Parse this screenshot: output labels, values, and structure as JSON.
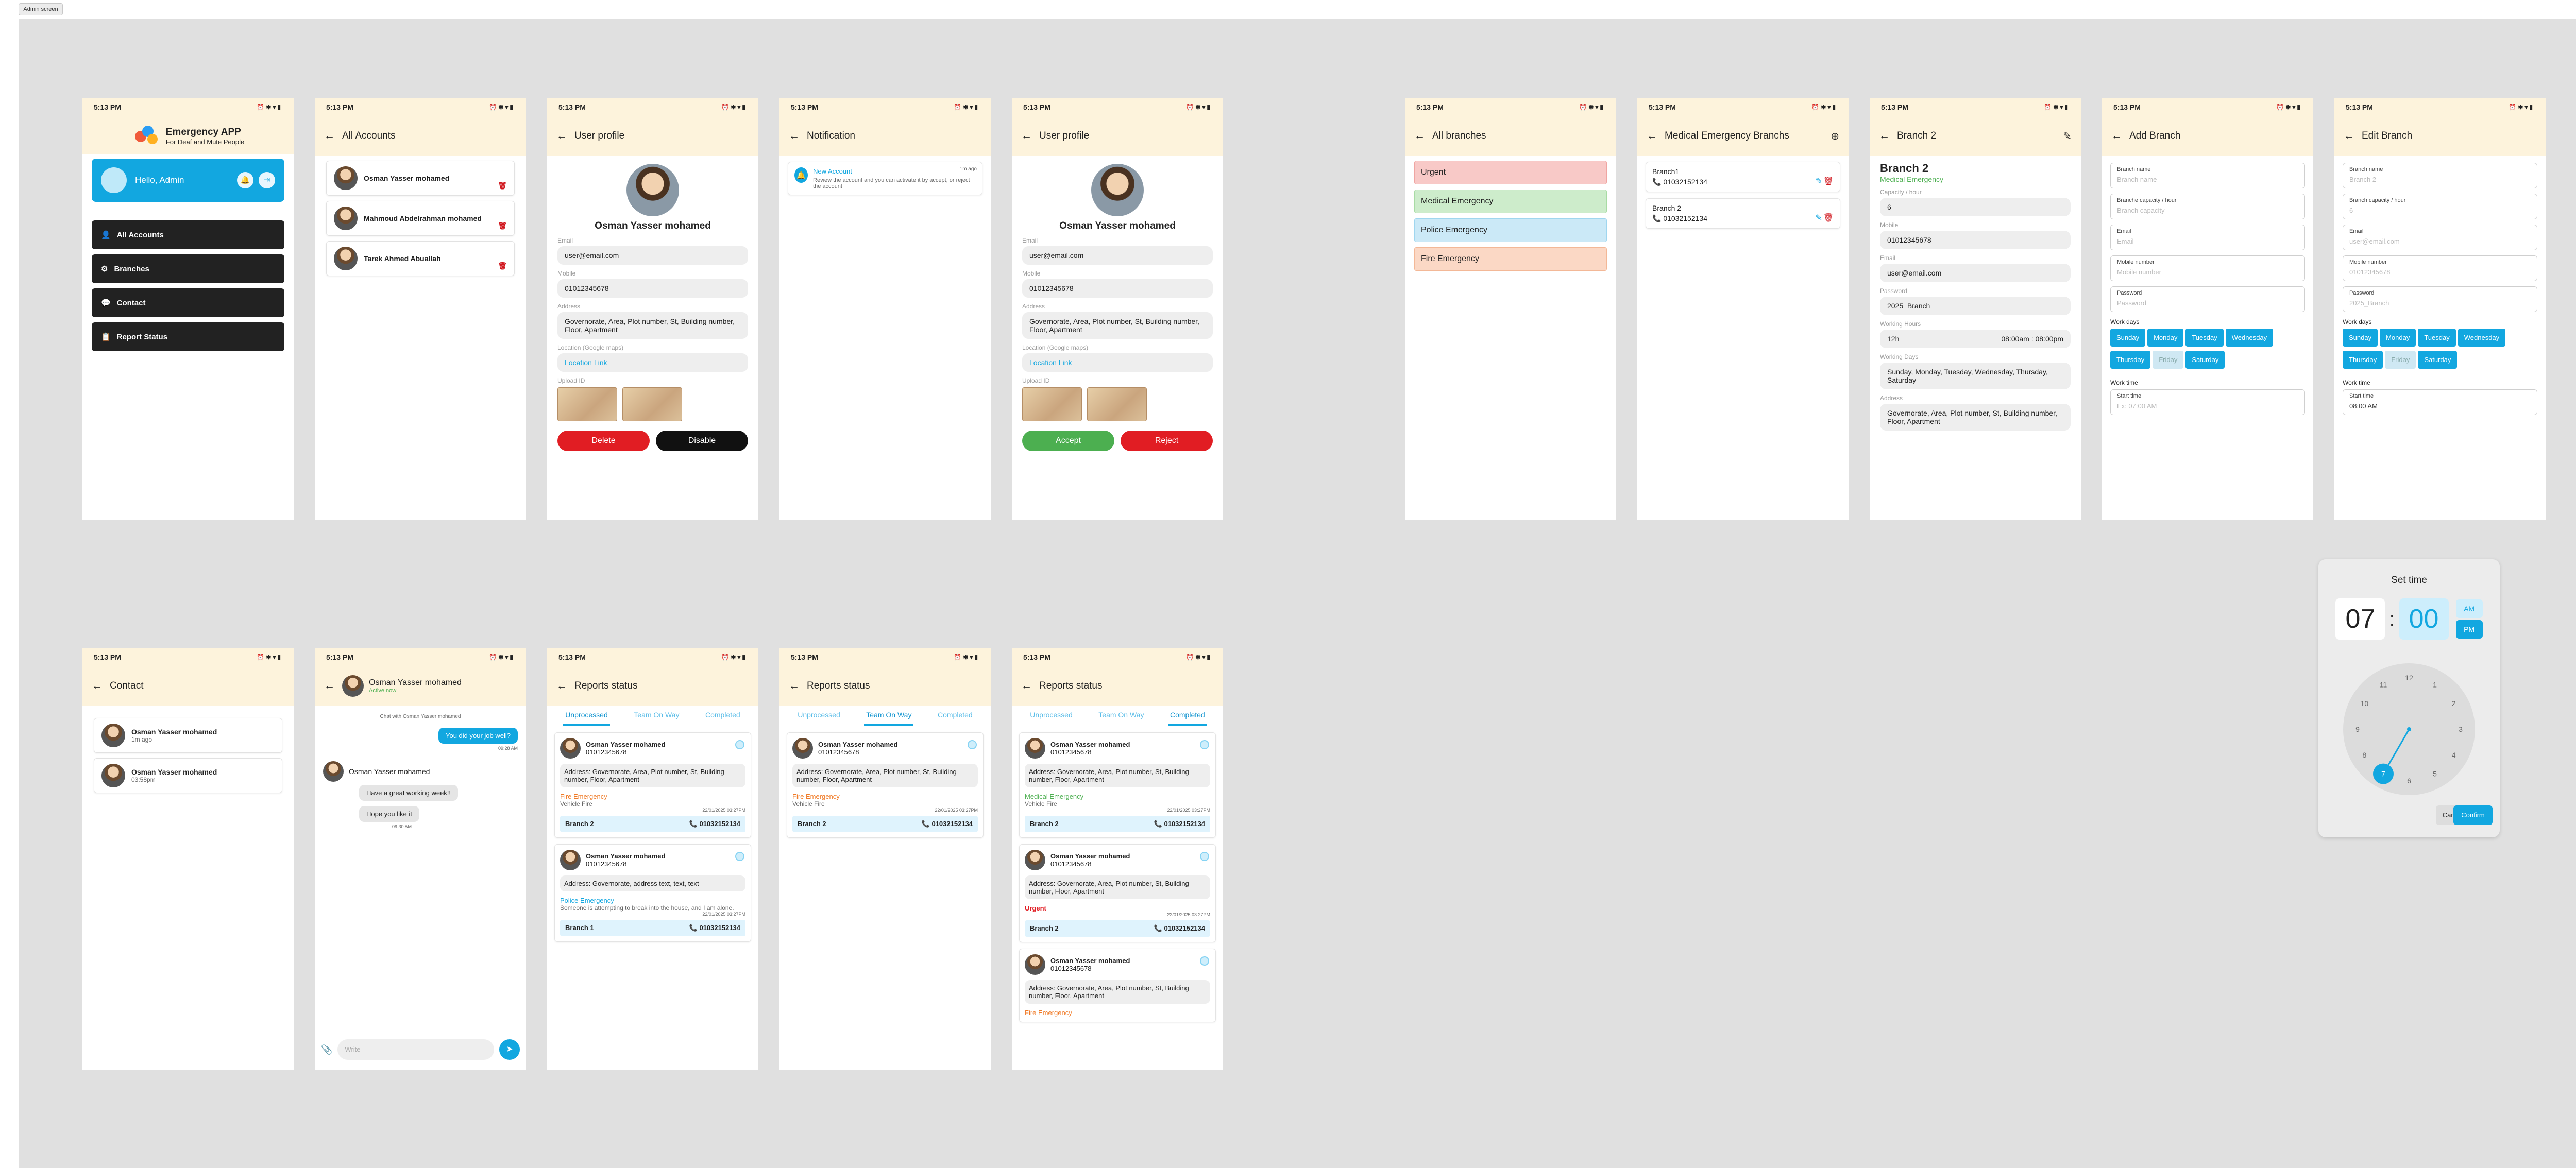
{
  "admin_tag": "Admin screen",
  "status": {
    "time": "5:13 PM"
  },
  "home": {
    "app_title": "Emergency APP",
    "app_subtitle": "For Deaf and Mute People",
    "greeting": "Hello, Admin",
    "menu": [
      "All Accounts",
      "Branches",
      "Contact",
      "Report Status"
    ],
    "colors": {
      "accent": "#12a7e0",
      "menu_bg": "#222222",
      "header_bg": "#fdf3dc"
    }
  },
  "accounts": {
    "title": "All Accounts",
    "items": [
      "Osman Yasser mohamed",
      "Mahmoud Abdelrahman mohamed",
      "Tarek Ahmed Abuallah"
    ]
  },
  "profile": {
    "title": "User profile",
    "name": "Osman Yasser mohamed",
    "email_label": "Email",
    "email": "user@email.com",
    "mobile_label": "Mobile",
    "mobile": "01012345678",
    "address_label": "Address",
    "address": "Governorate, Area, Plot number, St, Building number, Floor, Apartment",
    "location_label": "Location (Google maps)",
    "location": "Location Link",
    "upload_label": "Upload ID",
    "delete": "Delete",
    "disable": "Disable",
    "accept": "Accept",
    "reject": "Reject"
  },
  "notification": {
    "title": "Notification",
    "item_title": "New Account",
    "item_time": "1m ago",
    "item_body": "Review the account and you can activate it by accept, or reject the account"
  },
  "branches": {
    "title": "All branches",
    "items": [
      "Urgent",
      "Medical Emergency",
      "Police Emergency",
      "Fire Emergency"
    ]
  },
  "med_branches": {
    "title": "Medical Emergency Branchs",
    "items": [
      {
        "name": "Branch1",
        "phone": "01032152134"
      },
      {
        "name": "Branch 2",
        "phone": "01032152134"
      }
    ]
  },
  "branch_detail": {
    "title": "Branch 2",
    "name": "Branch 2",
    "type": "Medical Emergency",
    "capacity_label": "Capacity / hour",
    "capacity": "6",
    "mobile_label": "Mobile",
    "mobile": "01012345678",
    "email_label": "Email",
    "email": "user@email.com",
    "password_label": "Password",
    "password": "2025_Branch",
    "hours_label": "Working Hours",
    "hours": "12h",
    "hours_range": "08:00am : 08:00pm",
    "days_label": "Working Days",
    "days": "Sunday, Monday, Tuesday, Wednesday, Thursday, Saturday",
    "address_label": "Address",
    "address": "Governorate, Area, Plot number, St, Building number, Floor, Apartment"
  },
  "add_branch": {
    "title": "Add Branch",
    "fields": [
      {
        "label": "Branch name",
        "placeholder": "Branch name"
      },
      {
        "label": "Branche capacity / hour",
        "placeholder": "Branch capacity"
      },
      {
        "label": "Email",
        "placeholder": "Email"
      },
      {
        "label": "Mobile number",
        "placeholder": "Mobile number"
      },
      {
        "label": "Password",
        "placeholder": "Password"
      }
    ],
    "work_days_label": "Work days",
    "days": [
      "Sunday",
      "Monday",
      "Tuesday",
      "Wednesday",
      "Thursday",
      "Friday",
      "Saturday"
    ],
    "work_time_label": "Work time",
    "start_label": "Start time",
    "start_placeholder": "Ex: 07:00 AM"
  },
  "edit_branch": {
    "title": "Edit Branch",
    "fields": [
      {
        "label": "Branch name",
        "placeholder": "Branch 2"
      },
      {
        "label": "Branch capacity / hour",
        "placeholder": "6"
      },
      {
        "label": "Email",
        "placeholder": "user@email.com"
      },
      {
        "label": "Mobile number",
        "placeholder": "01012345678"
      },
      {
        "label": "Password",
        "placeholder": "2025_Branch"
      }
    ],
    "start_value": "08:00 AM"
  },
  "set_time": {
    "title": "Set time",
    "hour": "07",
    "minute": "00",
    "am": "AM",
    "pm": "PM",
    "numbers": [
      "12",
      "1",
      "2",
      "3",
      "4",
      "5",
      "6",
      "7",
      "8",
      "9",
      "10",
      "11"
    ],
    "cancel": "Cancel",
    "confirm": "Confirm"
  },
  "contact": {
    "title": "Contact",
    "items": [
      {
        "name": "Osman Yasser mohamed",
        "time": "1m ago"
      },
      {
        "name": "Osman Yasser mohamed",
        "time": "03:58pm"
      }
    ]
  },
  "chat": {
    "name": "Osman Yasser mohamed",
    "status": "Active now",
    "note": "Chat with Osman Yasser mohamed",
    "msg_out": "You did your job well?",
    "msg_out_time": "09:28 AM",
    "sender": "Osman Yasser mohamed",
    "msg_in1": "Have a great working week!!",
    "msg_in2": "Hope you like it",
    "msg_in_time": "09:30 AM",
    "input_placeholder": "Write"
  },
  "reports": {
    "title": "Reports status",
    "tabs": [
      "Unprocessed",
      "Team On Way",
      "Completed"
    ],
    "name": "Osman Yasser mohamed",
    "phone": "01012345678",
    "address": "Address: Governorate, Area, Plot number, St, Building number, Floor, Apartment",
    "address_short": "Address: Governorate, address text, text, text",
    "fire": "Fire Emergency",
    "fire_desc": "Vehicle Fire",
    "police": "Police Emergency",
    "police_desc": "Someone is attempting to break into the house, and I am alone.",
    "medical": "Medical Emergency",
    "urgent": "Urgent",
    "date": "22/01/2025 03:27PM",
    "branch2": "Branch 2",
    "branch1": "Branch 1",
    "branch_phone": "01032152134"
  }
}
